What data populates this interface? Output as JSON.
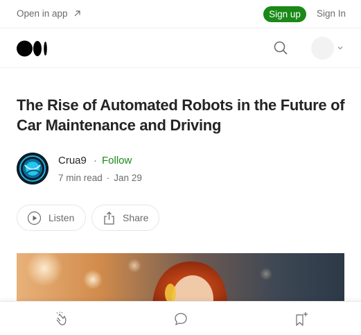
{
  "topbar": {
    "open_app": "Open in app",
    "signup": "Sign up",
    "signin": "Sign In"
  },
  "article": {
    "title": "The Rise of Automated Robots in the Future of Car Maintenance and Driving",
    "author": "Crua9",
    "separator": "·",
    "follow": "Follow",
    "read_time": "7 min read",
    "date": "Jan 29"
  },
  "actions": {
    "listen": "Listen",
    "share": "Share"
  },
  "colors": {
    "accent": "#1a8917",
    "text": "#242424",
    "muted": "#6b6b6b"
  },
  "icons": {
    "arrow": "external-arrow-icon",
    "search": "search-icon",
    "clap": "clap-icon",
    "comment": "comment-icon",
    "bookmark": "bookmark-add-icon"
  }
}
